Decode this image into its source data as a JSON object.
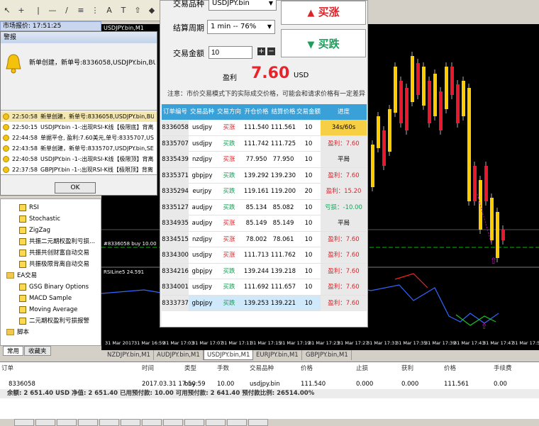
{
  "market_watch": {
    "title": "市场报价: 17:51:25"
  },
  "chart": {
    "title": "USDJPY.bin,M1",
    "ohlc": "111.548 1",
    "order_line_label": "#8336058 buy 10.00",
    "rsi_label": "RSILine5 24.591",
    "time_labels": [
      "31 Mar 2017",
      "31 Mar 16:59",
      "31 Mar 17:03",
      "31 Mar 17:07",
      "31 Mar 17:11",
      "31 Mar 17:15",
      "31 Mar 17:19",
      "31 Mar 17:23",
      "31 Mar 17:27",
      "31 Mar 17:31",
      "31 Mar 17:35",
      "31 Mar 17:39",
      "31 Mar 17:43",
      "31 Mar 17:47",
      "31 Mar 17:51"
    ]
  },
  "alert": {
    "title": "警报",
    "main_text": "新单创建，新单号:8336058,USDJPY.bin,BUY,10, 创建时",
    "rows": [
      {
        "time": "22:50:58",
        "message": "新单创建，新单号:8336058,USDJPY.bin,BUY,1..."
      },
      {
        "time": "22:50:15",
        "message": "USDJPY.bin -1-:出现RSI-K线【极限底】背离"
      },
      {
        "time": "22:44:58",
        "message": "单据平仓, 盈利:7.60美元,单号:8335707,USDJ..."
      },
      {
        "time": "22:43:58",
        "message": "新单创建，新单号:8335707,USDJPY.bin,SELL,..."
      },
      {
        "time": "22:40:58",
        "message": "USDJPY.bin -1-:出现RSI-K线【极限顶】背离"
      },
      {
        "time": "22:37:58",
        "message": "GBPJPY.bin -1-:出现RSI-K线【极限顶】背离"
      }
    ],
    "ok_label": "OK"
  },
  "navigator": {
    "items": [
      "RSI",
      "Stochastic",
      "ZigZag",
      "共振二元期权盈利亏损...",
      "共振共创财富自动交易",
      "共振极限背离自动交易"
    ],
    "ea_folder": "EA交易",
    "ea_items": [
      "GSG Binary Options",
      "MACD Sample",
      "Moving Average",
      "二元期权盈利亏损报警"
    ],
    "scripts_folder": "脚本",
    "tabs": [
      "常用",
      "收藏夹"
    ]
  },
  "panel": {
    "symbol_label": "交易品种",
    "symbol_value": "USDJPY.bin",
    "period_label": "结算周期",
    "period_value": "1 min -- 76%",
    "amount_label": "交易金额",
    "amount_value": "10",
    "rise_label": "买涨",
    "fall_label": "买跌",
    "profit_label": "盈利",
    "profit_value": "7.60",
    "profit_unit": "USD",
    "notice": "注意：市价交易模式下的实际成交价格，可能会和请求价格有一定差异"
  },
  "orders": {
    "headers": [
      "订单编号",
      "交易品种",
      "交易方向",
      "开仓价格",
      "结算价格",
      "交易金额",
      "进度"
    ],
    "rows": [
      [
        "8336058",
        "usdjpy",
        "买涨",
        "111.540",
        "111.561",
        "10",
        "34s/60s"
      ],
      [
        "8335707",
        "usdjpy",
        "买跌",
        "111.742",
        "111.725",
        "10",
        "盈利：7.60"
      ],
      [
        "8335439",
        "nzdjpy",
        "买涨",
        "77.950",
        "77.950",
        "10",
        "平局"
      ],
      [
        "8335371",
        "gbpjpy",
        "买跌",
        "139.292",
        "139.230",
        "10",
        "盈利：7.60"
      ],
      [
        "8335294",
        "eurjpy",
        "买跌",
        "119.161",
        "119.200",
        "20",
        "盈利：15.20"
      ],
      [
        "8335127",
        "audjpy",
        "买跌",
        "85.134",
        "85.082",
        "10",
        "亏损：-10.00"
      ],
      [
        "8334935",
        "audjpy",
        "买涨",
        "85.149",
        "85.149",
        "10",
        "平局"
      ],
      [
        "8334515",
        "nzdjpy",
        "买涨",
        "78.002",
        "78.061",
        "10",
        "盈利：7.60"
      ],
      [
        "8334300",
        "usdjpy",
        "买涨",
        "111.713",
        "111.762",
        "10",
        "盈利：7.60"
      ],
      [
        "8334216",
        "gbpjpy",
        "买跌",
        "139.244",
        "139.218",
        "10",
        "盈利：7.60"
      ],
      [
        "8334001",
        "usdjpy",
        "买跌",
        "111.692",
        "111.657",
        "10",
        "盈利：7.60"
      ],
      [
        "8333737",
        "gbpjpy",
        "买跌",
        "139.253",
        "139.221",
        "10",
        "盈利：7.60"
      ]
    ]
  },
  "symbol_tabs": [
    "NZDJPY.bin,M1",
    "AUDJPY.bin,M1",
    "USDJPY.bin,M1",
    "EURJPY.bin,M1",
    "GBPJPY.bin,M1"
  ],
  "terminal": {
    "headers": [
      "订单",
      "时间",
      "类型",
      "手数",
      "交易品种",
      "价格",
      "止损",
      "获利",
      "价格",
      "手续费"
    ],
    "row": [
      "8336058",
      "2017.03.31 17:50:59",
      "buy",
      "10.00",
      "usdjpy.bin",
      "111.540",
      "0.000",
      "0.000",
      "111.561",
      "0.00"
    ],
    "balance": "余额: 2 651.40 USD  净值: 2 651.40  已用预付款: 10.00  可用预付款: 2 641.40  预付款比例: 26514.00%"
  },
  "colors": {
    "rise": "#d9262c",
    "fall": "#1aa05a",
    "header": "#3aa0d8",
    "candle_up": "#ffcc00",
    "candle_down": "#e8192c"
  }
}
